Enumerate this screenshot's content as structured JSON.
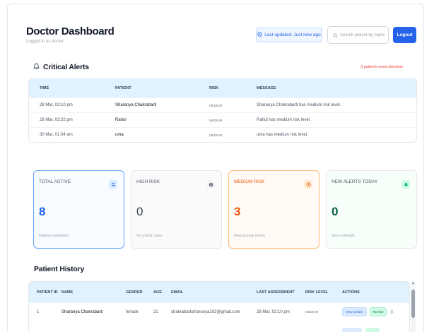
{
  "header": {
    "title": "Doctor Dashboard",
    "subtitle": "Logged in as doctor",
    "last_updated": "Last updated: Just now ago",
    "search_placeholder": "Search patient by name",
    "logout_label": "Logout"
  },
  "alerts": {
    "title": "Critical Alerts",
    "attention": "3 patients need attention",
    "columns": [
      "TIME",
      "PATIENT",
      "RISK",
      "MESSAGE"
    ],
    "rows": [
      {
        "time": "28 Mar, 03:10 pm",
        "patient": "Sharanya Chakrabarti",
        "risk": "MEDIUM",
        "message": "Sharanya Chakrabarti has medium risk level."
      },
      {
        "time": "28 Mar, 03:32 pm",
        "patient": "Rahul",
        "risk": "MEDIUM",
        "message": "Rahul has medium risk level."
      },
      {
        "time": "30 Mar, 01:04 am",
        "patient": "uma",
        "risk": "MEDIUM",
        "message": "uma has medium risk level."
      }
    ]
  },
  "stats": [
    {
      "label": "TOTAL ACTIVE",
      "value": "8",
      "note": "Patients monitored",
      "icon": "people-icon",
      "color": "#2563eb"
    },
    {
      "label": "HIGH RISK",
      "value": "0",
      "note": "No critical cases",
      "icon": "info-icon",
      "color": "#374151"
    },
    {
      "label": "MEDIUM RISK",
      "value": "3",
      "note": "Need priority review",
      "icon": "clock-icon",
      "color": "#ea580c"
    },
    {
      "label": "NEW ALERTS TODAY",
      "value": "0",
      "note": "Since midnight",
      "icon": "bell-icon",
      "color": "#065f46"
    }
  ],
  "history": {
    "title": "Patient History",
    "columns": [
      "PATIENT ID",
      "NAME",
      "GENDER",
      "AGE",
      "EMAIL",
      "LAST ASSESSMENT",
      "RISK LEVEL",
      "ACTIONS"
    ],
    "rows": [
      {
        "id": "1",
        "name": "Sharanya Chakrabarti",
        "gender": "female",
        "age": "21",
        "email": "chakrabartisharanya102@gmail.com",
        "last": "28 Mar, 03:10 pm",
        "risk": "MEDIUM",
        "view": "View Details",
        "review": "Review"
      }
    ]
  }
}
